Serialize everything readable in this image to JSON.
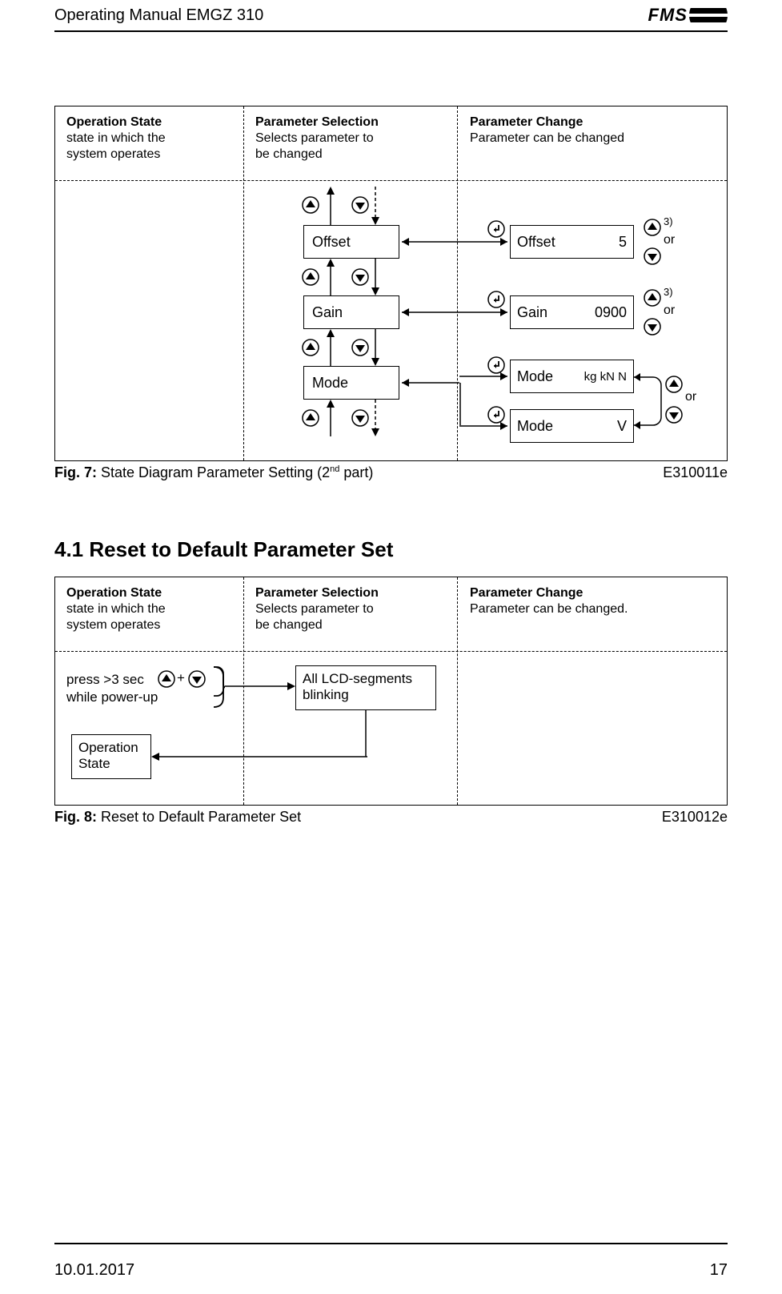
{
  "header": {
    "title": "Operating Manual EMGZ 310",
    "logo_text": "FMS"
  },
  "fig7": {
    "col1": {
      "title": "Operation State",
      "desc1": "state in which the",
      "desc2": "system operates"
    },
    "col2": {
      "title": "Parameter Selection",
      "desc1": "Selects parameter to",
      "desc2": "be changed"
    },
    "col3": {
      "title": "Parameter Change",
      "desc1": "Parameter can be changed"
    },
    "offset_label": "Offset",
    "gain_label": "Gain",
    "mode_label": "Mode",
    "offset_val_label": "Offset",
    "offset_val": "5",
    "gain_val_label": "Gain",
    "gain_val": "0900",
    "mode_units_label": "Mode",
    "mode_units": "kg kN N",
    "mode_v_label": "Mode",
    "mode_v": "V",
    "note3_a": "3)",
    "note3_b": "3)",
    "or_a": "or",
    "or_b": "or",
    "or_c": "or",
    "caption_prefix": "Fig. 7:",
    "caption_text_a": " State Diagram Parameter Setting (2",
    "caption_nd": "nd",
    "caption_text_b": "  part)",
    "caption_code": "E310011e"
  },
  "section41": "4.1  Reset to Default Parameter Set",
  "fig8": {
    "col1": {
      "title": "Operation State",
      "desc1": "state in which the",
      "desc2": "system operates"
    },
    "col2": {
      "title": "Parameter Selection",
      "desc1": "Selects parameter to",
      "desc2": "be changed"
    },
    "col3": {
      "title": "Parameter Change",
      "desc1": "Parameter can be changed."
    },
    "press1": "press >3 sec",
    "press2": "while power-up",
    "plus": "+",
    "lcd1": "All LCD-segments",
    "lcd2": "blinking",
    "opstate_box1": "Operation",
    "opstate_box2": "State",
    "caption_prefix": "Fig. 8:",
    "caption_text": " Reset to Default Parameter Set",
    "caption_code": "E310012e"
  },
  "footer": {
    "date": "10.01.2017",
    "page": "17"
  }
}
